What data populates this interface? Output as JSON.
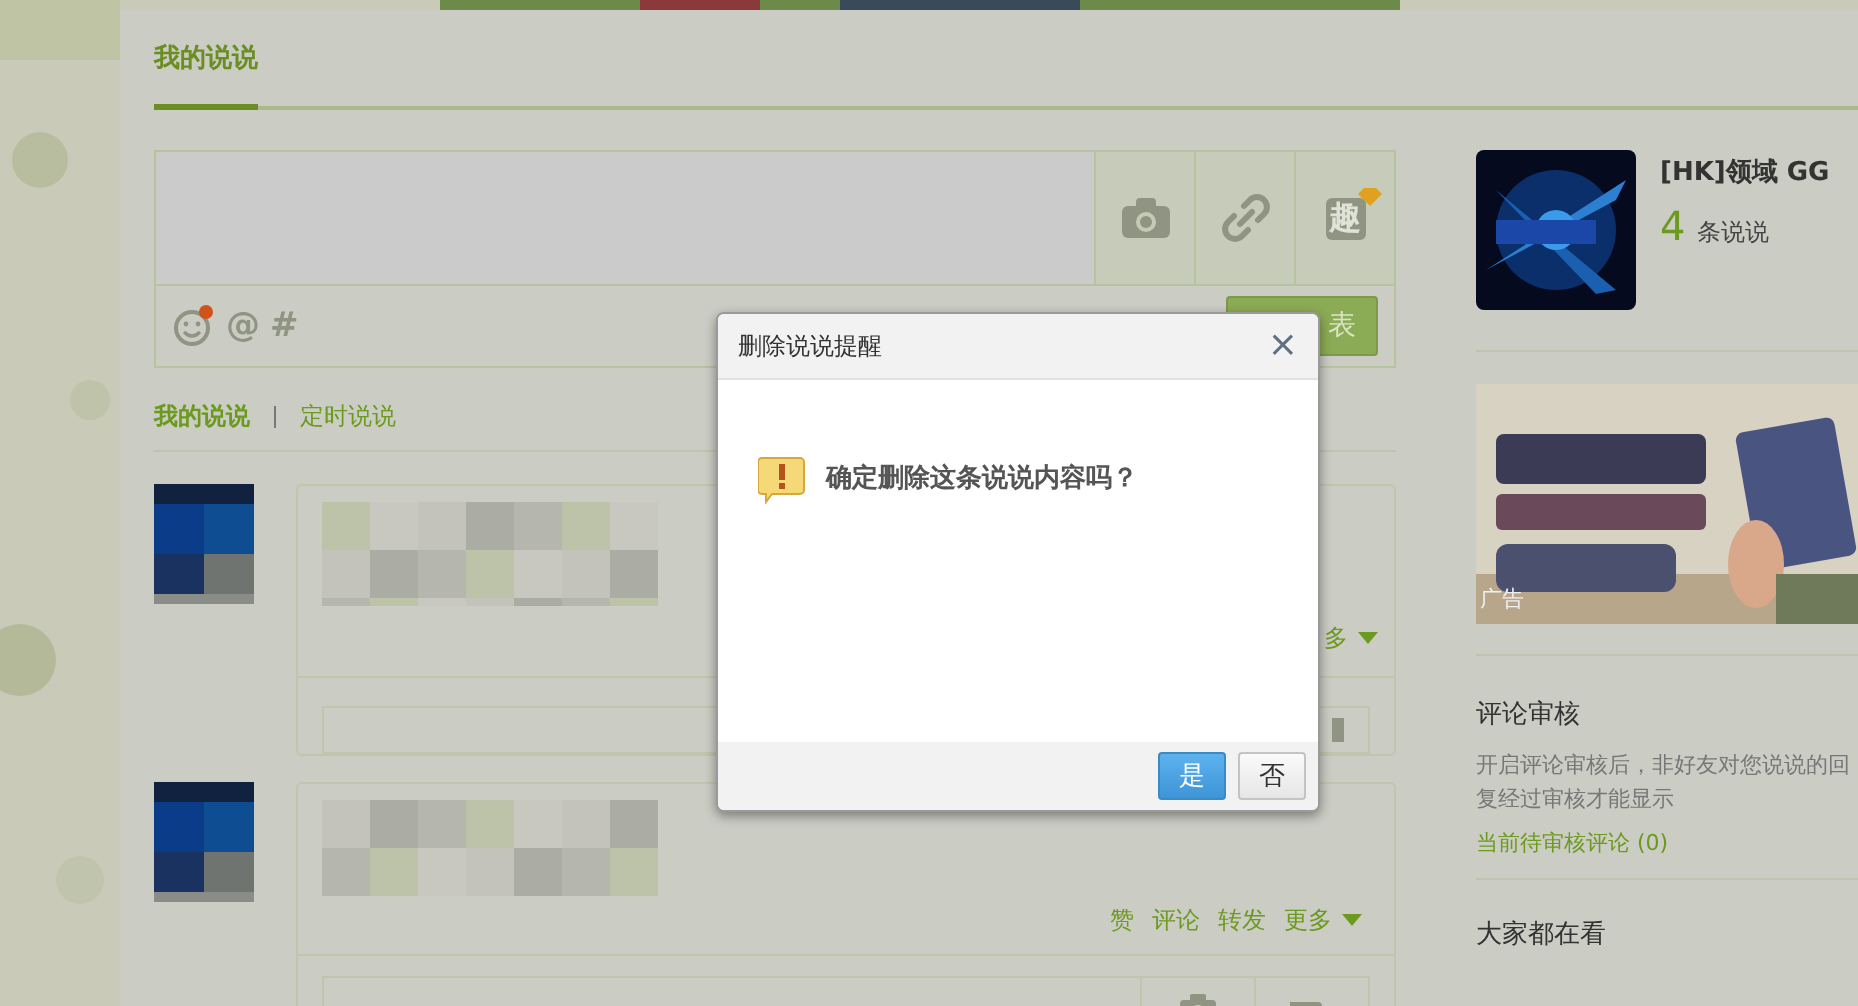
{
  "tabs": [
    {
      "label": "我的说说",
      "selected": true
    }
  ],
  "composer": {
    "tools": [
      {
        "kind": "camera"
      },
      {
        "kind": "link"
      },
      {
        "kind": "fun",
        "label": "趣"
      }
    ],
    "inserts": [
      {
        "kind": "emoji",
        "new": true
      },
      {
        "kind": "text",
        "label": "@"
      },
      {
        "kind": "text",
        "label": "#"
      }
    ],
    "publish_button": "表"
  },
  "filters": [
    {
      "label": "我的说说",
      "selected": true
    },
    {
      "label": "定时说说",
      "selected": false
    }
  ],
  "posts": [
    {
      "actions": [
        {
          "label": "多",
          "kind": "menu"
        }
      ],
      "comment_tools": [
        {
          "kind": "video"
        }
      ]
    },
    {
      "actions": [
        {
          "label": "赞",
          "kind": "plain"
        },
        {
          "label": "评论",
          "kind": "plain"
        },
        {
          "label": "转发",
          "kind": "plain"
        },
        {
          "label": "更多",
          "kind": "menu"
        }
      ],
      "comment_tools": [
        {
          "kind": "camera"
        },
        {
          "kind": "hand"
        }
      ]
    }
  ],
  "profile": {
    "name": "[HK]领域 GG",
    "count": "4",
    "count_label": "条说说"
  },
  "ad": {
    "kind": "picture",
    "label": "广告"
  },
  "review": {
    "title": "评论审核",
    "description": "开启评论审核后，非好友对您说说的回复经过审核才能显示",
    "link": "当前待审核评论 (0)"
  },
  "trending": {
    "title": "大家都在看"
  },
  "dialog": {
    "title": "删除说说提醒",
    "close": "×",
    "message": "确定删除这条说说内容吗？",
    "buttons": [
      {
        "label": "是",
        "primary": true
      },
      {
        "label": "否",
        "primary": false
      }
    ]
  }
}
